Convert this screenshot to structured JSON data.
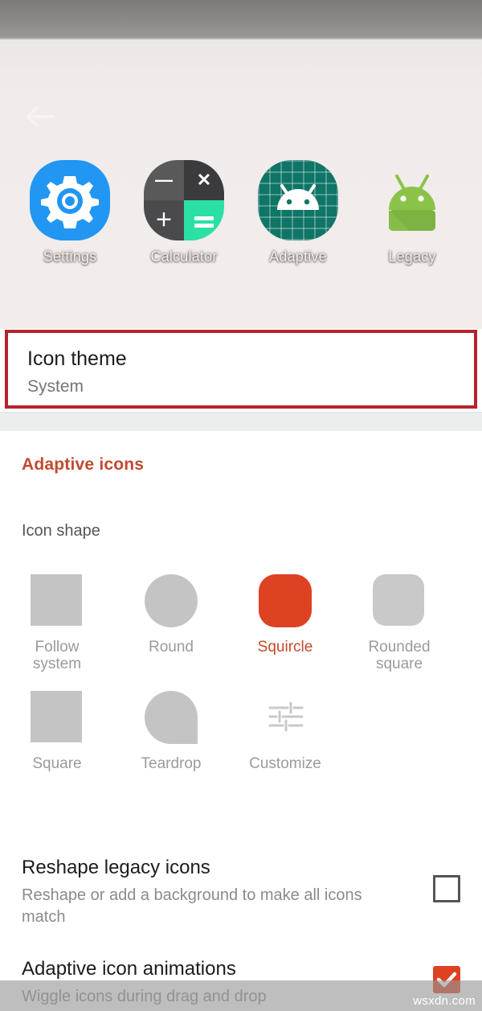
{
  "statusbar": {
    "present": true
  },
  "navigation": {
    "back_icon": "arrow-left-icon"
  },
  "preview": {
    "apps": [
      {
        "name": "Settings",
        "icon": "settings-gear-icon",
        "bg_color": "#2196f3"
      },
      {
        "name": "Calculator",
        "icon": "calculator-icon",
        "bg_color": "#3b3b3d",
        "symbols": {
          "minus": "—",
          "times": "✕",
          "plus": "＋",
          "equals": "="
        }
      },
      {
        "name": "Adaptive",
        "icon": "android-head-grid-icon",
        "bg_color": "#0f7566"
      },
      {
        "name": "Legacy",
        "icon": "android-robot-icon",
        "bg_color": "#8bc34a"
      }
    ]
  },
  "icon_theme": {
    "title": "Icon theme",
    "value": "System",
    "highlight_color": "#b5232d"
  },
  "adaptive_section": {
    "header": "Adaptive icons",
    "header_color": "#c14a31",
    "icon_shape_label": "Icon shape",
    "shapes": [
      {
        "label": "Follow\nsystem",
        "shape": "square",
        "selected": false
      },
      {
        "label": "Round",
        "shape": "circle",
        "selected": false
      },
      {
        "label": "Squircle",
        "shape": "squircle",
        "selected": true
      },
      {
        "label": "Rounded\nsquare",
        "shape": "rounded-square",
        "selected": false
      },
      {
        "label": "Square",
        "shape": "square",
        "selected": false
      },
      {
        "label": "Teardrop",
        "shape": "teardrop",
        "selected": false
      },
      {
        "label": "Customize",
        "shape": "sliders-icon",
        "selected": false
      }
    ],
    "selected_color": "#dd4222"
  },
  "preferences": [
    {
      "title": "Reshape legacy icons",
      "summary": "Reshape or add a background to make all icons match",
      "checked": false
    },
    {
      "title": "Adaptive icon animations",
      "summary": "Wiggle icons during drag and drop",
      "checked": true
    }
  ],
  "watermark": {
    "text": "wsxdn.com"
  }
}
